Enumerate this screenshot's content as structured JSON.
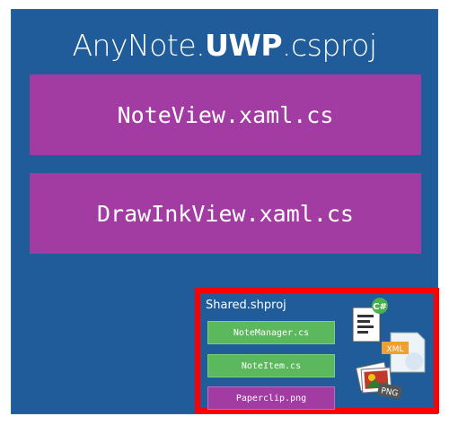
{
  "project": {
    "title_prefix": "AnyNote.",
    "title_bold": "UWP",
    "title_suffix": ".csproj",
    "files": [
      "NoteView.xaml.cs",
      "DrawInkView.xaml.cs"
    ]
  },
  "shared": {
    "title": "Shared.shproj",
    "items": [
      "NoteManager.cs",
      "NoteItem.cs",
      "Paperclip.png"
    ],
    "icon_labels": {
      "csharp": "C#",
      "xml": "XML",
      "png": "PNG"
    }
  },
  "colors": {
    "background": "#1f5c99",
    "file_box": "#a23ca3",
    "highlight": "#ff0000",
    "shared_code": "#5cb85c"
  }
}
